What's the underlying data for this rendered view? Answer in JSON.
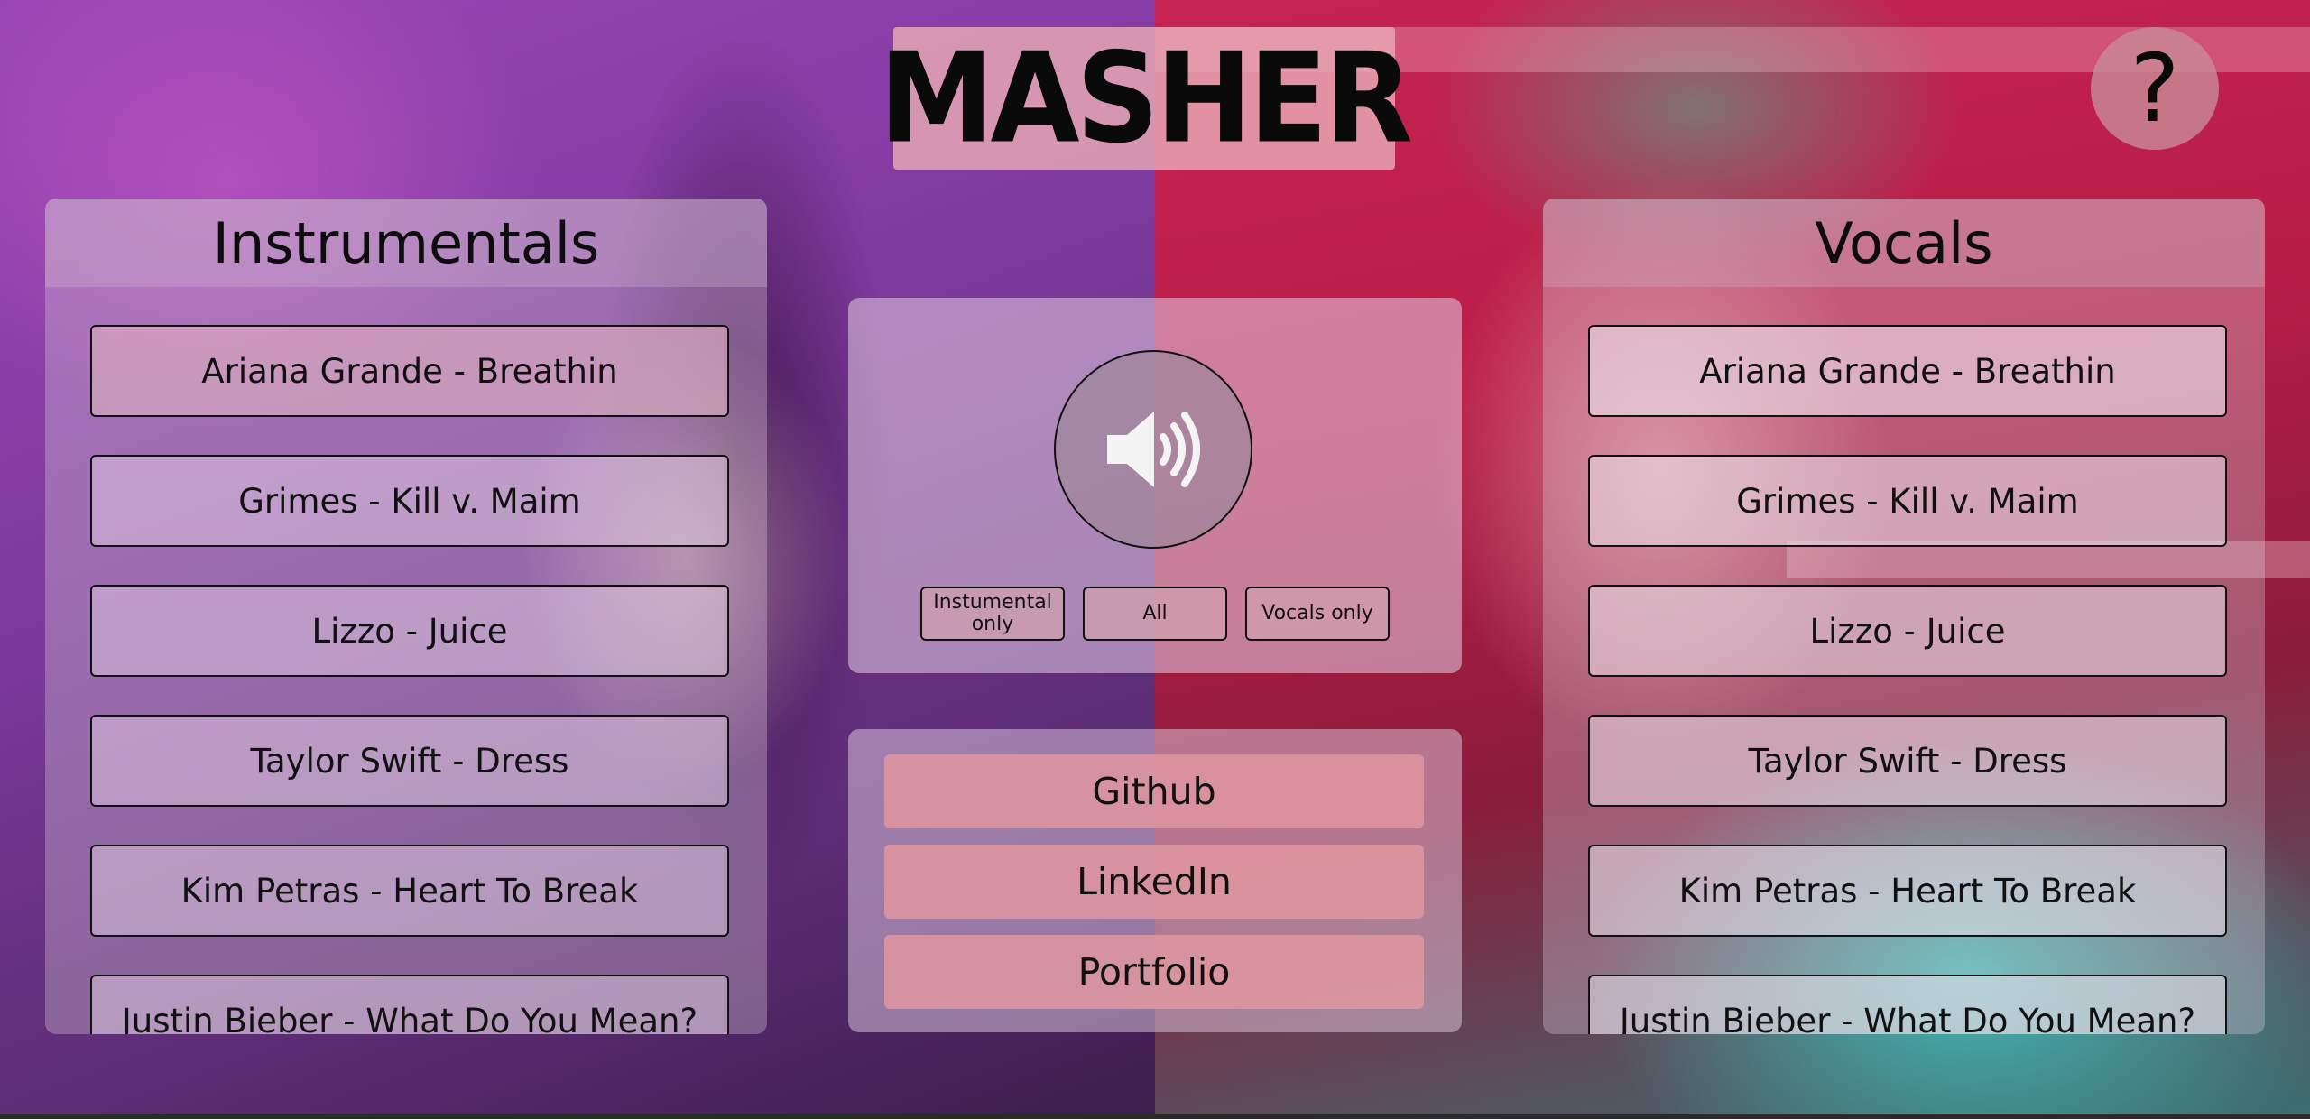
{
  "header": {
    "logo_text": "MASHER",
    "help_label": "?"
  },
  "instrumentals": {
    "title": "Instrumentals",
    "songs": [
      "Ariana Grande - Breathin",
      "Grimes - Kill v. Maim",
      "Lizzo - Juice",
      "Taylor Swift - Dress",
      "Kim Petras - Heart To Break",
      "Justin Bieber - What Do You Mean?"
    ]
  },
  "vocals": {
    "title": "Vocals",
    "songs": [
      "Ariana Grande - Breathin",
      "Grimes - Kill v. Maim",
      "Lizzo - Juice",
      "Taylor Swift - Dress",
      "Kim Petras - Heart To Break",
      "Justin Bieber - What Do You Mean?"
    ]
  },
  "controls": {
    "play_icon": "speaker-volume-icon",
    "modes": [
      "Instumental only",
      "All",
      "Vocals only"
    ]
  },
  "links": [
    "Github",
    "LinkedIn",
    "Portfolio"
  ],
  "colors": {
    "left_background": "#8a3fa8",
    "right_background": "#c2224e",
    "accent_pink": "#e196a0"
  }
}
